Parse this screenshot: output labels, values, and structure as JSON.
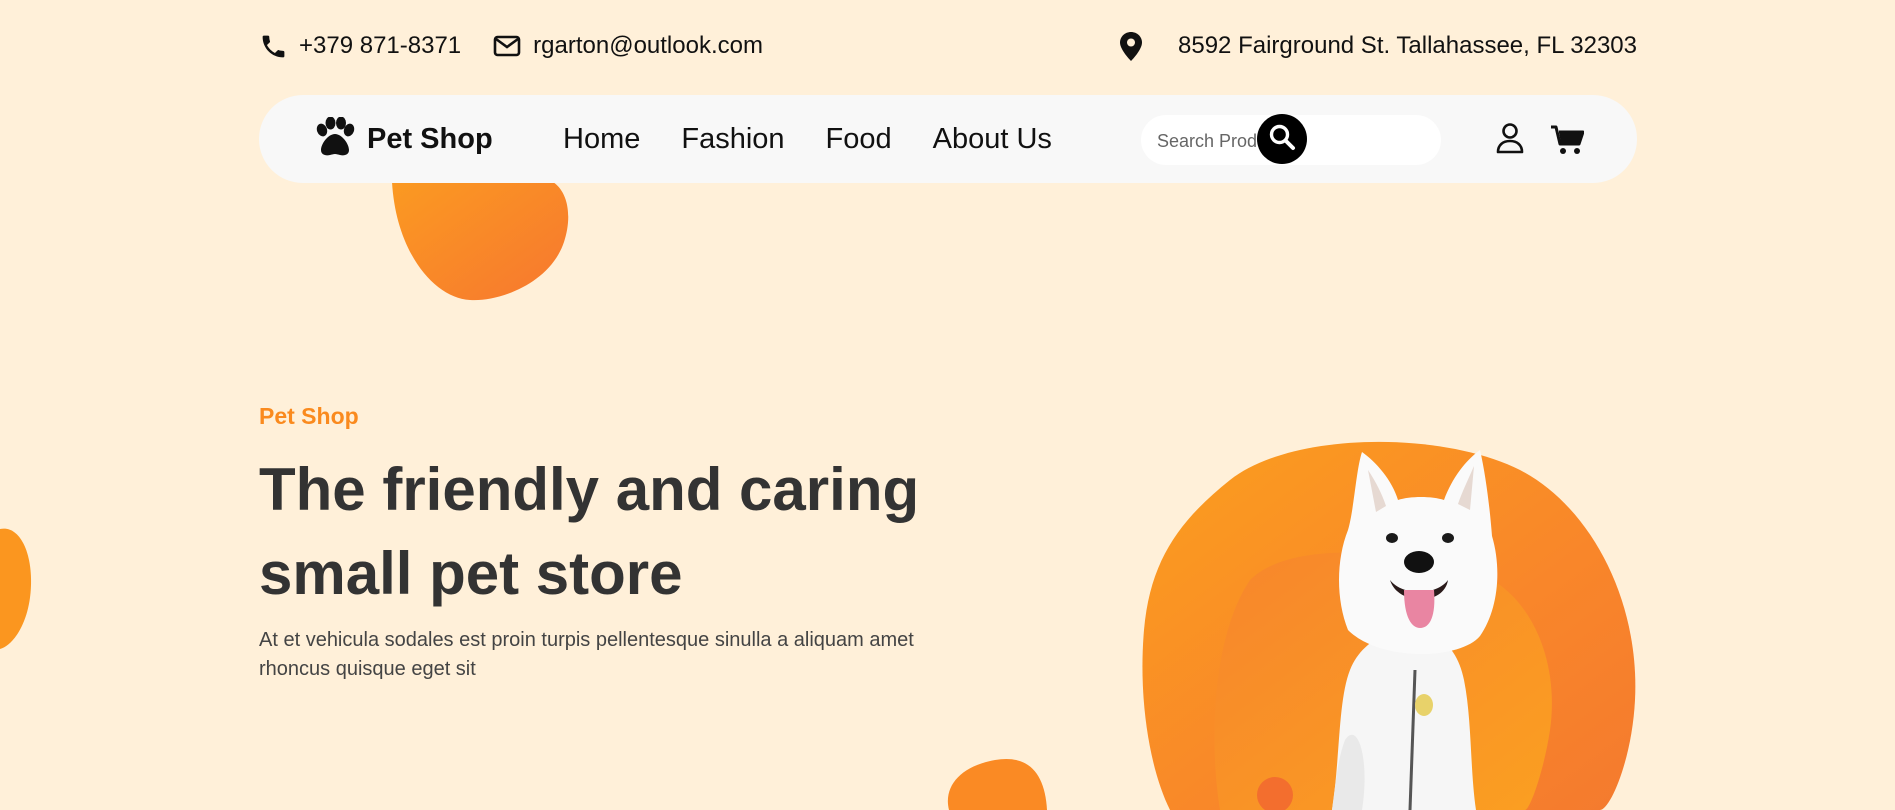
{
  "topbar": {
    "phone": "+379 871-8371",
    "email": "rgarton@outlook.com",
    "address": "8592 Fairground St. Tallahassee, FL 32303"
  },
  "nav": {
    "logo_text": "Pet Shop",
    "links": [
      "Home",
      "Fashion",
      "Food",
      "About Us"
    ],
    "search_placeholder": "Search Products..."
  },
  "hero": {
    "label": "Pet Shop",
    "title": "The friendly and caring small pet store",
    "description": "At et vehicula sodales est proin turpis pellentesque sinulla a aliquam amet rhoncus quisque eget sit"
  },
  "icons": {
    "phone": "phone-icon",
    "email": "envelope-icon",
    "address": "map-pin-icon",
    "logo": "paw-icon",
    "search": "search-icon",
    "user": "user-icon",
    "cart": "cart-icon"
  },
  "colors": {
    "background": "#FFF0D9",
    "accent": "#FA8A1E",
    "navbar": "#F8F8F8",
    "text_dark": "#333333"
  }
}
